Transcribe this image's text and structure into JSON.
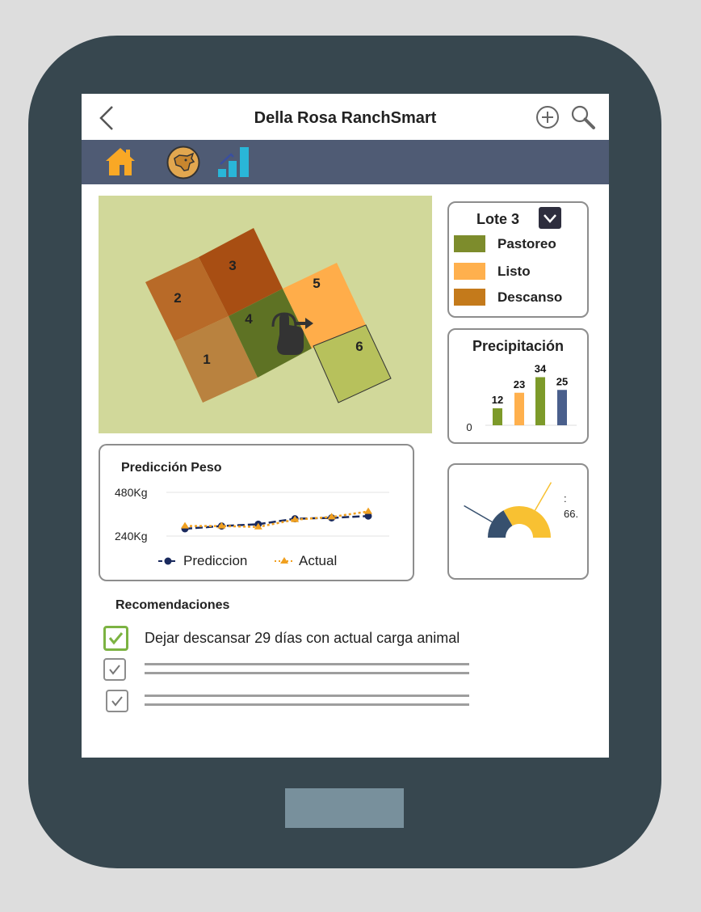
{
  "app": {
    "title": "Della Rosa RanchSmart"
  },
  "topbar": {
    "back_icon": "chevron-left-icon",
    "add_icon": "plus-circle-icon",
    "search_icon": "search-icon"
  },
  "navbar": {
    "items": [
      {
        "icon": "home-icon",
        "color": "#f9a825"
      },
      {
        "icon": "cow-icon",
        "color": "#e2a74f"
      },
      {
        "icon": "bar-chart-icon",
        "color": "#29b6d8"
      }
    ]
  },
  "map": {
    "selected_icon": "tap-swipe-hand-icon",
    "plots": [
      {
        "label": "1",
        "status": "Descanso"
      },
      {
        "label": "2",
        "status": "Descanso"
      },
      {
        "label": "3",
        "status": "Descanso"
      },
      {
        "label": "4",
        "status": "Pastoreo"
      },
      {
        "label": "5",
        "status": "Listo"
      },
      {
        "label": "6",
        "status": ""
      }
    ]
  },
  "lote": {
    "title": "Lote 3",
    "dropdown_icon": "chevron-down-icon",
    "legend": [
      {
        "label": "Pastoreo",
        "color": "#7d8c2c"
      },
      {
        "label": "Listo",
        "color": "#ffb04d"
      },
      {
        "label": "Descanso",
        "color": "#c47a1b"
      }
    ]
  },
  "precipitacion": {
    "title": "Precipitación",
    "zero_label": "0"
  },
  "peso": {
    "title": "Predicción Peso",
    "y_top": "480Kg",
    "y_bottom": "240Kg",
    "legend": {
      "prediccion": "Prediccion",
      "actual": "Actual"
    }
  },
  "gauge": {
    "label": ":\n66."
  },
  "recomendaciones": {
    "title": "Recomendaciones",
    "items": [
      {
        "text": "Dejar descansar 29 días con actual carga animal",
        "checked": true
      },
      {
        "text": "",
        "checked": false
      },
      {
        "text": "",
        "checked": false
      }
    ]
  },
  "chart_data": [
    {
      "type": "bar",
      "title": "Precipitación",
      "categories": [
        "",
        "",
        "",
        ""
      ],
      "values": [
        12,
        23,
        34,
        25
      ],
      "colors": [
        "#7d9a2a",
        "#ffb04d",
        "#7d9a2a",
        "#4a5f8c"
      ],
      "ylim": [
        0,
        40
      ]
    },
    {
      "type": "line",
      "title": "Predicción Peso",
      "x": [
        1,
        2,
        3,
        4,
        5,
        6
      ],
      "ylim": [
        240,
        480
      ],
      "series": [
        {
          "name": "Prediccion",
          "values": [
            280,
            295,
            305,
            335,
            340,
            350
          ],
          "color": "#1a2a5e"
        },
        {
          "name": "Actual",
          "values": [
            295,
            295,
            290,
            330,
            345,
            375
          ],
          "color": "#f0a020"
        }
      ]
    },
    {
      "type": "pie",
      "title": "",
      "values": [
        33.3,
        66.7
      ],
      "colors": [
        "#37506e",
        "#f8c132"
      ]
    }
  ]
}
